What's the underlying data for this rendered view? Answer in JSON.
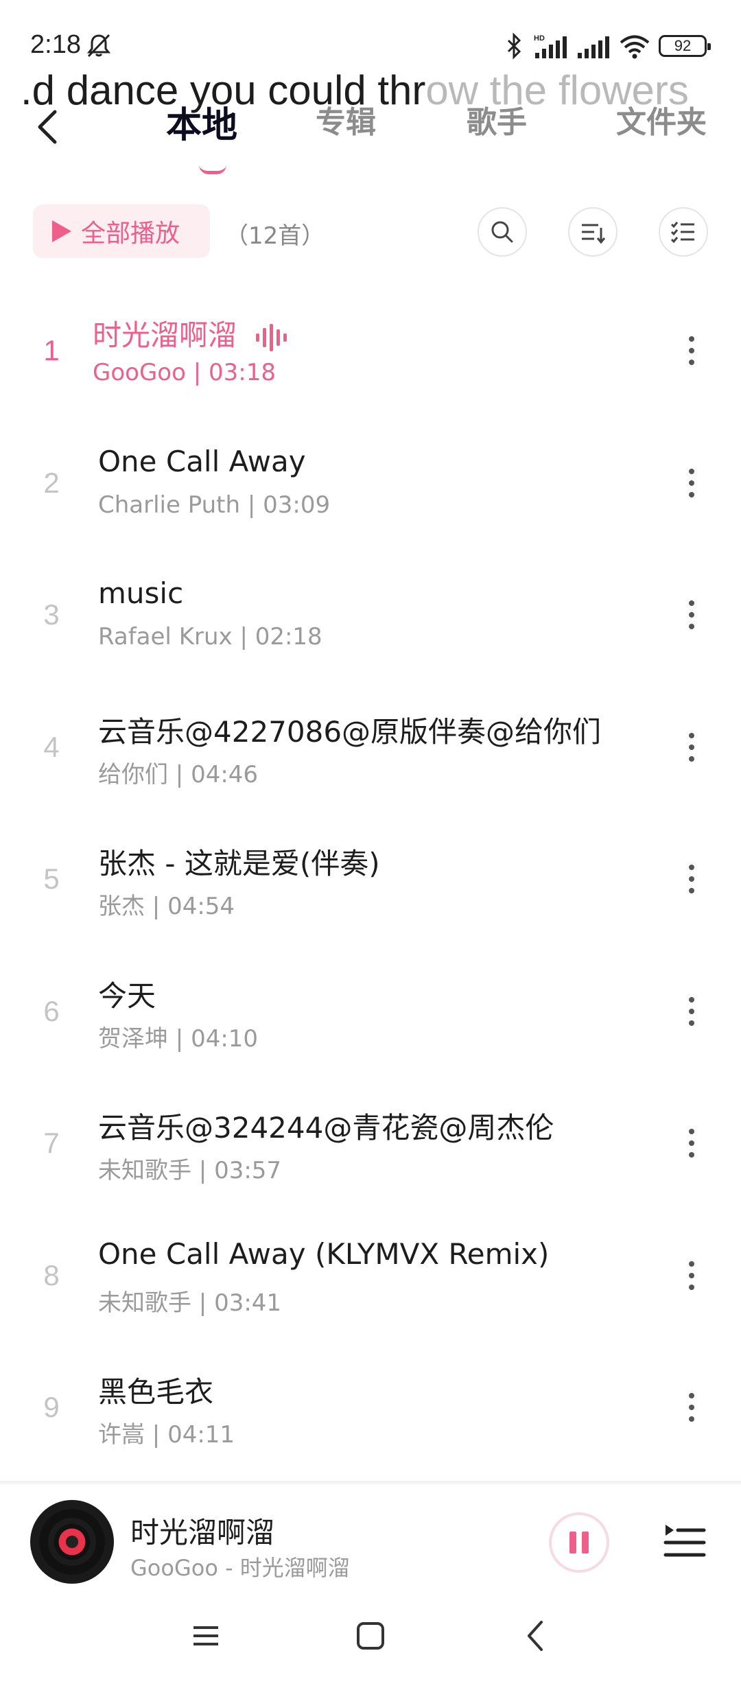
{
  "status_bar": {
    "time": "2:18",
    "battery": "92"
  },
  "lyric": {
    "sung": ".d dance you could thr",
    "unsung": "ow the flowers"
  },
  "tabs": [
    {
      "label": "本地",
      "active": true
    },
    {
      "label": "专辑",
      "active": false
    },
    {
      "label": "歌手",
      "active": false
    },
    {
      "label": "文件夹",
      "active": false
    }
  ],
  "toolbar": {
    "play_all_label": "全部播放",
    "count_label": "（12首）"
  },
  "songs": [
    {
      "index": "1",
      "title": "时光溜啊溜",
      "subtitle": "GooGoo | 03:18",
      "playing": true
    },
    {
      "index": "2",
      "title": "One Call Away",
      "subtitle": "Charlie Puth | 03:09"
    },
    {
      "index": "3",
      "title": "music",
      "subtitle": "Rafael Krux | 02:18"
    },
    {
      "index": "4",
      "title": "云音乐@4227086@原版伴奏@给你们",
      "subtitle": "给你们 | 04:46"
    },
    {
      "index": "5",
      "title": "张杰 - 这就是爱(伴奏)",
      "subtitle": "张杰 | 04:54"
    },
    {
      "index": "6",
      "title": "今天",
      "subtitle": "贺泽坤 | 04:10"
    },
    {
      "index": "7",
      "title": "云音乐@324244@青花瓷@周杰伦",
      "subtitle": "未知歌手 | 03:57"
    },
    {
      "index": "8",
      "title": "One Call Away (KLYMVX Remix)",
      "subtitle": "未知歌手 | 03:41"
    },
    {
      "index": "9",
      "title": "黑色毛衣",
      "subtitle": "许嵩 | 04:11"
    }
  ],
  "now_playing": {
    "title": "时光溜啊溜",
    "subtitle": "GooGoo - 时光溜啊溜"
  },
  "colors": {
    "accent": "#ee5f8b",
    "accent_bg": "#fdeef2"
  }
}
